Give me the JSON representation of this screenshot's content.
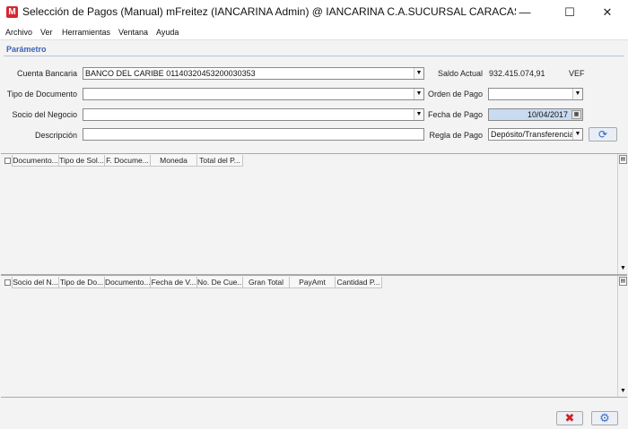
{
  "window": {
    "title": "Selección de Pagos (Manual)  mFreitez (IANCARINA Admin) @ IANCARINA C.A.SUCURSAL CARACAS YAGUARA [vmade...",
    "minimize": "—",
    "maximize": "☐",
    "close": "✕"
  },
  "menu": [
    "Archivo",
    "Ver",
    "Herramientas",
    "Ventana",
    "Ayuda"
  ],
  "section_title": "Parámetro",
  "form": {
    "cuenta_label": "Cuenta Bancaria",
    "cuenta_value": "BANCO DEL CARIBE 01140320453200030353",
    "tipo_doc_label": "Tipo de Documento",
    "tipo_doc_value": "",
    "socio_label": "Socio del Negocio",
    "socio_value": "",
    "descripcion_label": "Descripción",
    "descripcion_value": "",
    "saldo_label": "Saldo Actual",
    "saldo_value": "932.415.074,91",
    "saldo_currency": "VEF",
    "orden_label": "Orden de Pago",
    "orden_value": "",
    "fecha_label": "Fecha de Pago",
    "fecha_value": "10/04/2017",
    "regla_label": "Regla de Pago",
    "regla_value": "Depósito/Transferencia"
  },
  "grid1": {
    "columns": [
      "Documento...",
      "Tipo de Sol...",
      "F. Docume...",
      "Moneda",
      "Total del P..."
    ]
  },
  "grid2": {
    "columns": [
      "Socio del N...",
      "Tipo de Do...",
      "Documento...",
      "Fecha de V...",
      "No. De Cue...",
      "Gran Total",
      "PayAmt",
      "Cantidad P..."
    ]
  },
  "icons": {
    "dropdown": "▼",
    "scroll_down": "▼",
    "refresh": "⟳",
    "cancel": "✖",
    "process": "⚙"
  }
}
